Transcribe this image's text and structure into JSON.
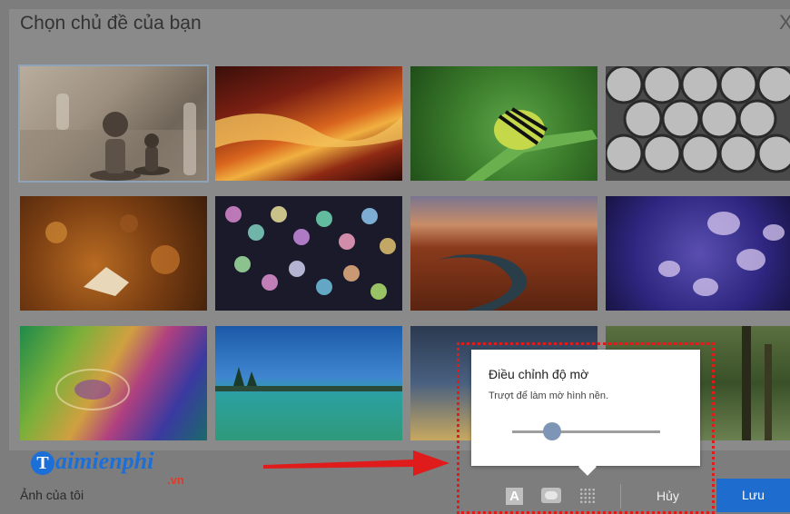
{
  "dialog": {
    "title": "Chọn chủ đề của bạn",
    "close_symbol": "X"
  },
  "themes": [
    {
      "name": "chess"
    },
    {
      "name": "canyon-light"
    },
    {
      "name": "caterpillar"
    },
    {
      "name": "pipes"
    },
    {
      "name": "autumn-leaves"
    },
    {
      "name": "bokeh-lights"
    },
    {
      "name": "river-canyon"
    },
    {
      "name": "jellyfish"
    },
    {
      "name": "rainbow-water"
    },
    {
      "name": "lake-islands"
    },
    {
      "name": "coast-beach"
    },
    {
      "name": "forest"
    }
  ],
  "blur_popup": {
    "title": "Điều chỉnh độ mờ",
    "subtitle": "Trượt để làm mờ hình nền.",
    "slider_value": 0.27
  },
  "bottom_bar": {
    "my_photos": "Ảnh của tôi",
    "mode_a_label": "A",
    "cancel_label": "Hủy",
    "save_label": "Lưu"
  },
  "watermark": {
    "text": "aimienphi",
    "initial": "T",
    "suffix": ".vn"
  },
  "colors": {
    "accent": "#1f6ccf",
    "highlight": "#e01b1b"
  }
}
